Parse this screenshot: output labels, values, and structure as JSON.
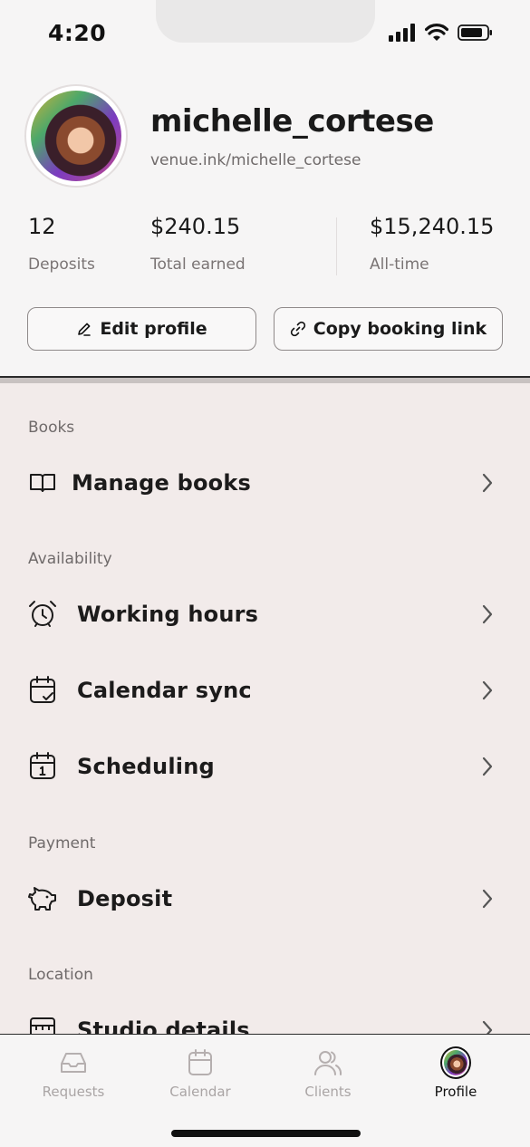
{
  "status_bar": {
    "time": "4:20"
  },
  "profile": {
    "username": "michelle_cortese",
    "booking_url": "venue.ink/michelle_cortese",
    "stats": [
      {
        "value": "12",
        "label": "Deposits"
      },
      {
        "value": "$240.15",
        "label": "Total earned"
      },
      {
        "value": "$15,240.15",
        "label": "All-time"
      }
    ],
    "edit_profile_label": "Edit profile",
    "copy_link_label": "Copy booking link"
  },
  "sections": {
    "books": {
      "title": "Books",
      "items": [
        {
          "label": "Manage books",
          "icon": "book-icon"
        }
      ]
    },
    "availability": {
      "title": "Availability",
      "items": [
        {
          "label": "Working hours",
          "icon": "alarm-clock-icon"
        },
        {
          "label": "Calendar sync",
          "icon": "calendar-check-icon"
        },
        {
          "label": "Scheduling",
          "icon": "calendar-day-icon"
        }
      ]
    },
    "payment": {
      "title": "Payment",
      "items": [
        {
          "label": "Deposit",
          "icon": "piggy-bank-icon"
        }
      ]
    },
    "location": {
      "title": "Location",
      "items": [
        {
          "label": "Studio details",
          "icon": "studio-icon"
        }
      ]
    }
  },
  "tabbar": {
    "tabs": [
      {
        "label": "Requests",
        "icon": "inbox-icon",
        "active": false
      },
      {
        "label": "Calendar",
        "icon": "calendar-icon",
        "active": false
      },
      {
        "label": "Clients",
        "icon": "users-icon",
        "active": false
      },
      {
        "label": "Profile",
        "icon": "avatar",
        "active": true
      }
    ]
  }
}
